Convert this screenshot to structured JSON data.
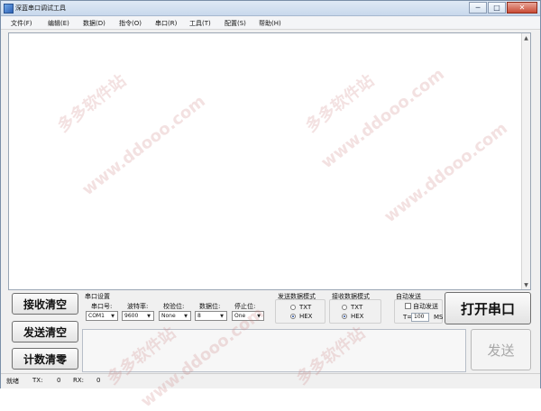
{
  "window": {
    "title": "深蓝串口调试工具",
    "controls": {
      "minimize": "─",
      "maximize": "□",
      "close": "✕"
    }
  },
  "menu": [
    "文件(F)",
    "编辑(E)",
    "数据(D)",
    "指令(O)",
    "串口(R)",
    "工具(T)",
    "配置(S)",
    "帮助(H)"
  ],
  "buttons": {
    "clear_receive": "接收清空",
    "clear_send": "发送清空",
    "clear_count": "计数清零",
    "open_port": "打开串口",
    "send": "发送"
  },
  "port_settings": {
    "group_title": "串口设置",
    "port": {
      "label": "串口号:",
      "value": "COM1"
    },
    "baud": {
      "label": "波特率:",
      "value": "9600"
    },
    "parity": {
      "label": "校验位:",
      "value": "None"
    },
    "data_bits": {
      "label": "数据位:",
      "value": "8"
    },
    "stop_bits": {
      "label": "停止位:",
      "value": "One"
    }
  },
  "send_mode": {
    "title": "发送数据模式",
    "options": [
      "TXT",
      "HEX"
    ],
    "selected": "HEX"
  },
  "receive_mode": {
    "title": "接收数据模式",
    "options": [
      "TXT",
      "HEX"
    ],
    "selected": "HEX"
  },
  "auto_send": {
    "title": "自动发送",
    "checkbox_label": "自动发送",
    "interval_label": "T=",
    "interval_value": "100",
    "unit": "MS"
  },
  "status": {
    "state": "就绪",
    "tx_label": "TX:",
    "tx_value": "0",
    "rx_label": "RX:",
    "rx_value": "0"
  },
  "watermark": [
    "多多软件站",
    "www.ddooo.com"
  ],
  "icons": {
    "combo_arrow": "▼",
    "scroll_up": "▲",
    "scroll_down": "▼"
  },
  "colors": {
    "window_bg": "#f0f0f0",
    "titlebar": "#c8d8ec",
    "close_button": "#c94b35",
    "watermark": "#c87878"
  }
}
